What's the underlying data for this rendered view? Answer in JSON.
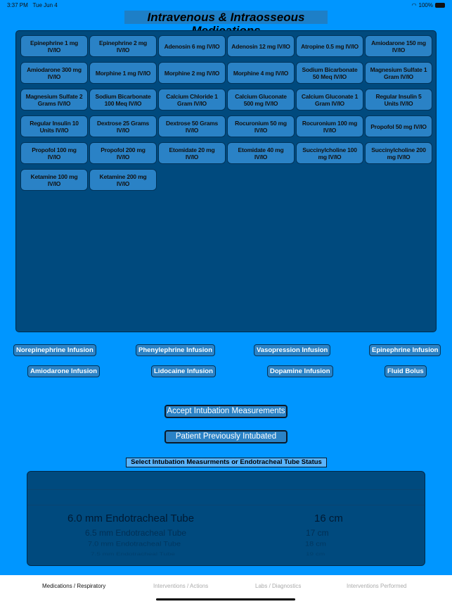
{
  "status": {
    "time": "3:37 PM",
    "date": "Tue Jun 4",
    "battery": "100%"
  },
  "title": "Intravenous & Intraosseous Medications",
  "medications": [
    "Epinephrine 1 mg IV/IO",
    "Epinephrine 2 mg IV/IO",
    "Adenosin 6 mg IV/IO",
    "Adenosin 12 mg IV/IO",
    "Atropine 0.5 mg IV/IO",
    "Amiodarone 150 mg IV/IO",
    "Amiodarone 300 mg IV/IO",
    "Morphine 1 mg IV/IO",
    "Morphine 2 mg IV/IO",
    "Morphine 4 mg IV/IO",
    "Sodium Bicarbonate 50 Meq IV/IO",
    "Magnesium Sulfate 1 Gram IV/IO",
    "Magnesium Sulfate 2 Grams IV/IO",
    "Sodium Bicarbonate 100 Meq IV/IO",
    "Calcium Chloride 1 Gram IV/IO",
    "Calcium Gluconate 500 mg IV/IO",
    "Calcium Gluconate 1 Gram IV/IO",
    "Regular Insulin 5 Units IV/IO",
    "Regular Insulin 10 Units IV/IO",
    "Dextrose 25 Grams IV/IO",
    "Dextrose 50 Grams IV/IO",
    "Rocuronium 50 mg IV/IO",
    "Rocuronium 100 mg IV/IO",
    "Propofol 50 mg IV/IO",
    "Propofol 100 mg IV/IO",
    "Propofol 200 mg IV/IO",
    "Etomidate 20 mg IV/IO",
    "Etomidate 40 mg IV/IO",
    "Succinylcholine 100 mg IV/IO",
    "Succinylcholine 200 mg IV/IO",
    "Ketamine 100 mg IV/IO",
    "Ketamine 200 mg IV/IO"
  ],
  "infusions": [
    "Norepinephrine Infusion",
    "Phenylephrine Infusion",
    "Vasopression Infusion",
    "Epinephrine Infusion",
    "Amiodarone Infusion",
    "Lidocaine Infusion",
    "Dopamine Infusion",
    "Fluid Bolus"
  ],
  "accept_button": "Accept Intubation Measurements",
  "previously_intubated_button": "Patient Previously Intubated",
  "picker_label": "Select Intubation Measurments or Endotracheal Tube Status",
  "picker": {
    "tubes": [
      "6.0 mm Endotracheal Tube",
      "6.5 mm Endotracheal Tube",
      "7.0 mm Endotracheal Tube",
      "7.5 mm Endotracheal Tube"
    ],
    "depths": [
      "16 cm",
      "17 cm",
      "18 cm",
      "19 cm"
    ],
    "selected_tube": "6.0 mm Endotracheal Tube",
    "selected_depth": "16 cm"
  },
  "tabs": [
    {
      "label": "Medications / Respiratory",
      "active": true
    },
    {
      "label": "Interventions / Actions"
    },
    {
      "label": "Labs / Diagnostics"
    },
    {
      "label": "Interventions Performed"
    }
  ],
  "colors": {
    "background": "#0096ff",
    "panel": "#004a7e",
    "button": "#2a82c6"
  }
}
